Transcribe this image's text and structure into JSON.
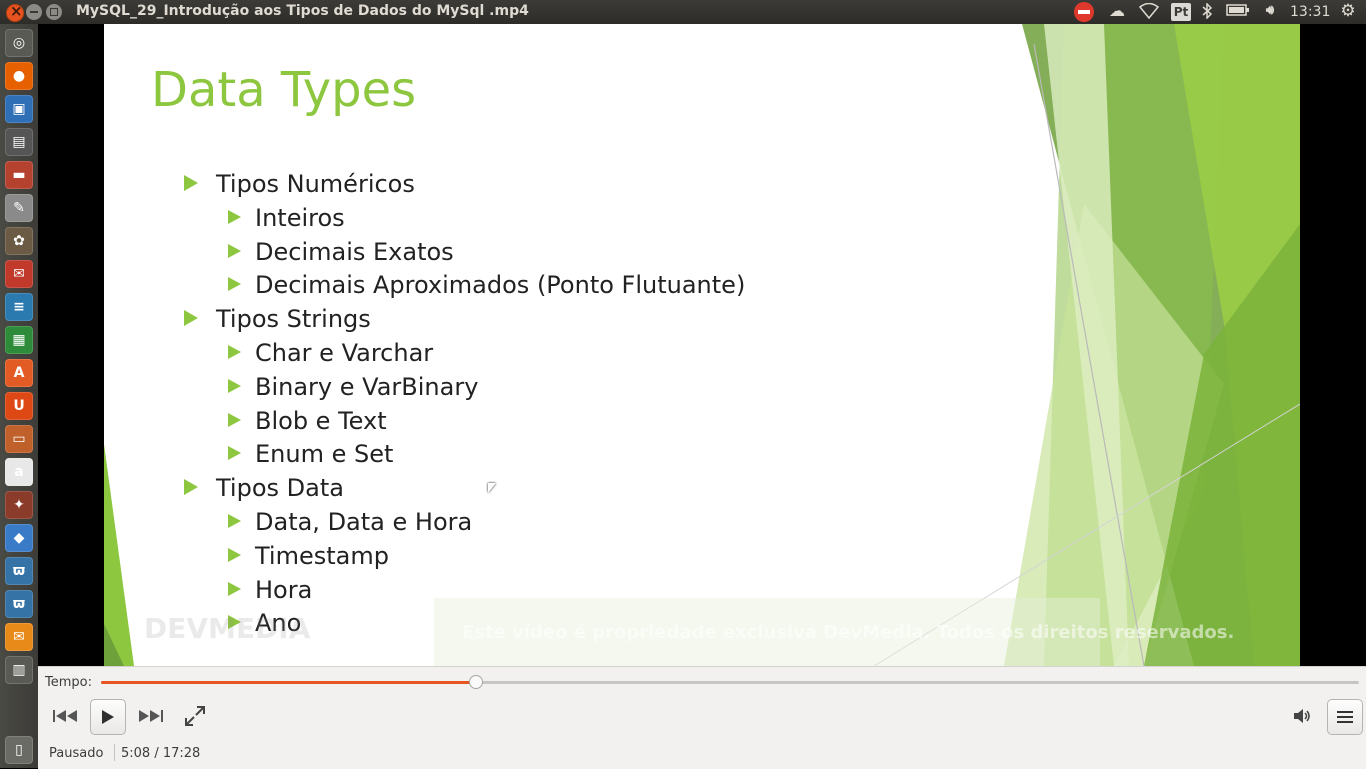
{
  "window": {
    "title": "MySQL_29_Introdução aos Tipos de Dados do MySql .mp4"
  },
  "tray": {
    "keyboard_layout": "Pt",
    "clock": "13:31"
  },
  "launcher": {
    "items": [
      {
        "name": "dash-home-icon",
        "glyph": "◎",
        "color": "#5a5a55"
      },
      {
        "name": "firefox-icon",
        "glyph": "●",
        "color": "#e66000"
      },
      {
        "name": "virtualbox-icon",
        "glyph": "▣",
        "color": "#2f6fb5"
      },
      {
        "name": "video-editor-icon",
        "glyph": "▤",
        "color": "#555"
      },
      {
        "name": "archive-manager-icon",
        "glyph": "▬",
        "color": "#b5412f"
      },
      {
        "name": "text-editor-icon",
        "glyph": "✎",
        "color": "#8a8a8a"
      },
      {
        "name": "gimp-icon",
        "glyph": "✿",
        "color": "#6b5b45"
      },
      {
        "name": "pdf-viewer-icon",
        "glyph": "✉",
        "color": "#c0392b"
      },
      {
        "name": "writer-icon",
        "glyph": "≡",
        "color": "#2a7ab0"
      },
      {
        "name": "calc-icon",
        "glyph": "▦",
        "color": "#2e8b3a"
      },
      {
        "name": "software-center-icon",
        "glyph": "A",
        "color": "#e35b24"
      },
      {
        "name": "ubuntu-one-icon",
        "glyph": "U",
        "color": "#dd4814"
      },
      {
        "name": "impress-icon",
        "glyph": "▭",
        "color": "#c0602a"
      },
      {
        "name": "amazon-icon",
        "glyph": "a",
        "color": "#e8e8e8"
      },
      {
        "name": "system-settings-icon",
        "glyph": "✦",
        "color": "#8a3b2a"
      },
      {
        "name": "cube-app-icon",
        "glyph": "◆",
        "color": "#3a7bc8"
      },
      {
        "name": "python-icon",
        "glyph": "ϖ",
        "color": "#3572a5"
      },
      {
        "name": "python-icon-2",
        "glyph": "ϖ",
        "color": "#3572a5"
      },
      {
        "name": "mail-icon",
        "glyph": "✉",
        "color": "#e88a1a"
      },
      {
        "name": "workspace-switcher-icon",
        "glyph": "▥",
        "color": "#5a5a55"
      },
      {
        "name": "trash-icon",
        "glyph": "▯",
        "color": "#6b6b66"
      }
    ]
  },
  "slide": {
    "title": "Data Types",
    "bullets": [
      {
        "level": 1,
        "text": "Tipos Numéricos"
      },
      {
        "level": 2,
        "text": "Inteiros"
      },
      {
        "level": 2,
        "text": "Decimais Exatos"
      },
      {
        "level": 2,
        "text": "Decimais Aproximados (Ponto Flutuante)"
      },
      {
        "level": 1,
        "text": "Tipos Strings"
      },
      {
        "level": 2,
        "text": "Char e Varchar"
      },
      {
        "level": 2,
        "text": "Binary e VarBinary"
      },
      {
        "level": 2,
        "text": "Blob e Text"
      },
      {
        "level": 2,
        "text": "Enum e Set"
      },
      {
        "level": 1,
        "text": "Tipos Data"
      },
      {
        "level": 2,
        "text": "Data, Data e Hora"
      },
      {
        "level": 2,
        "text": "Timestamp"
      },
      {
        "level": 2,
        "text": "Hora"
      },
      {
        "level": 2,
        "text": "Ano"
      }
    ],
    "watermark_logo": "DEVMEDIA",
    "watermark_text": "Este vídeo é propriedade exclusiva DevMedia. Todos os direitos reservados.",
    "accent_color": "#8dc63f"
  },
  "player": {
    "tempo_label": "Tempo:",
    "progress_fraction": 0.2979,
    "status": "Pausado",
    "time": "5:08 / 17:28",
    "accent_color": "#e95420"
  }
}
